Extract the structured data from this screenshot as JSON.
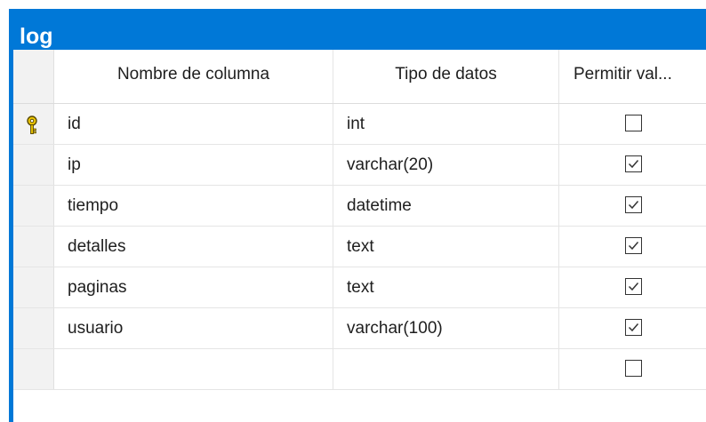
{
  "table": {
    "title": "log",
    "columns": {
      "name": "Nombre de columna",
      "type": "Tipo de datos",
      "nullable": "Permitir val..."
    },
    "rows": [
      {
        "name": "id",
        "type": "int",
        "allow_nulls": false,
        "primary_key": true,
        "key_icon": "key-icon"
      },
      {
        "name": "ip",
        "type": "varchar(20)",
        "allow_nulls": true
      },
      {
        "name": "tiempo",
        "type": "datetime",
        "allow_nulls": true
      },
      {
        "name": "detalles",
        "type": "text",
        "allow_nulls": true
      },
      {
        "name": "paginas",
        "type": "text",
        "allow_nulls": true
      },
      {
        "name": "usuario",
        "type": "varchar(100)",
        "allow_nulls": true
      },
      {
        "name": "",
        "type": "",
        "allow_nulls": false
      }
    ]
  },
  "colors": {
    "accent": "#0078d7",
    "key": "#d8b000"
  }
}
